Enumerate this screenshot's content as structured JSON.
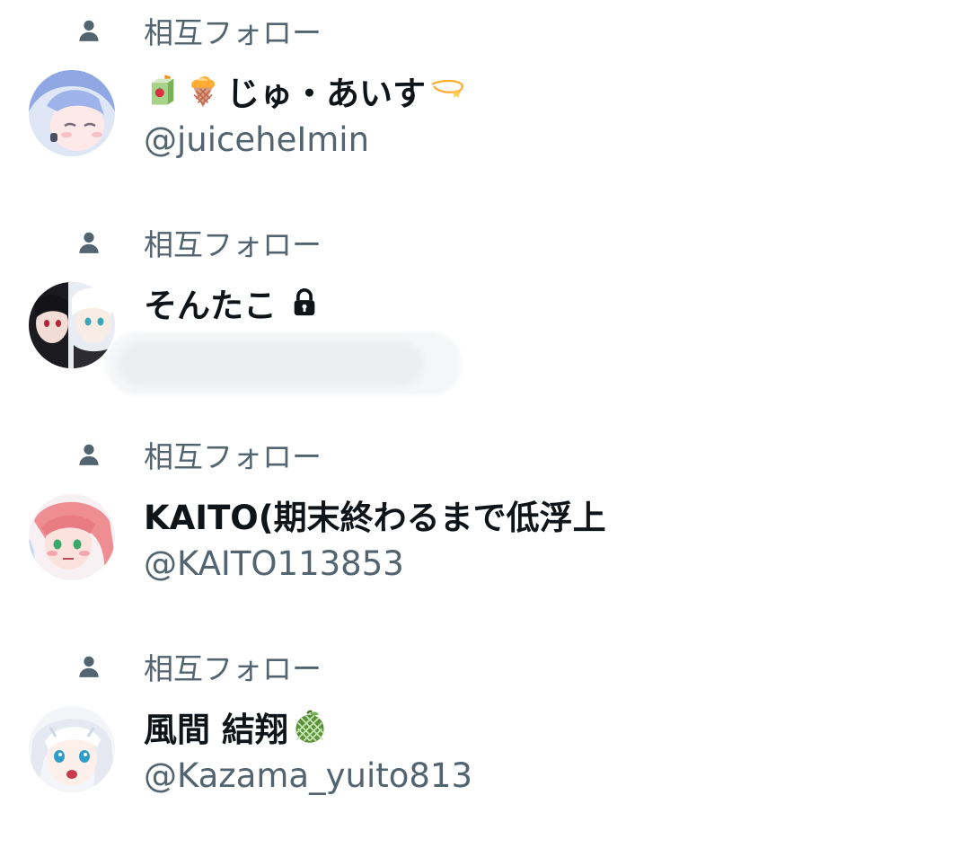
{
  "colors": {
    "name": "#0f1419",
    "secondary": "#536471",
    "background": "#ffffff"
  },
  "users": [
    {
      "social_context": "相互フォロー",
      "name": "じゅ・あいす",
      "handle": "@juiceheImin",
      "lead_icons": [
        "juice-box-icon",
        "ice-cream-icon"
      ],
      "trail_icon": "dizzy-star-icon",
      "avatar": "avatar-blue-hair"
    },
    {
      "social_context": "相互フォロー",
      "name": "そんたこ",
      "handle": "",
      "trail_icon": "lock-icon",
      "avatar": "avatar-dark-light"
    },
    {
      "social_context": "相互フォロー",
      "name": "KAITO(期末終わるまで低浮上",
      "handle": "@KAITO113853",
      "avatar": "avatar-pink-hair"
    },
    {
      "social_context": "相互フォロー",
      "name": "風間 結翔",
      "handle": "@Kazama_yuito813",
      "trail_icon": "melon-icon",
      "avatar": "avatar-white-hair"
    }
  ]
}
